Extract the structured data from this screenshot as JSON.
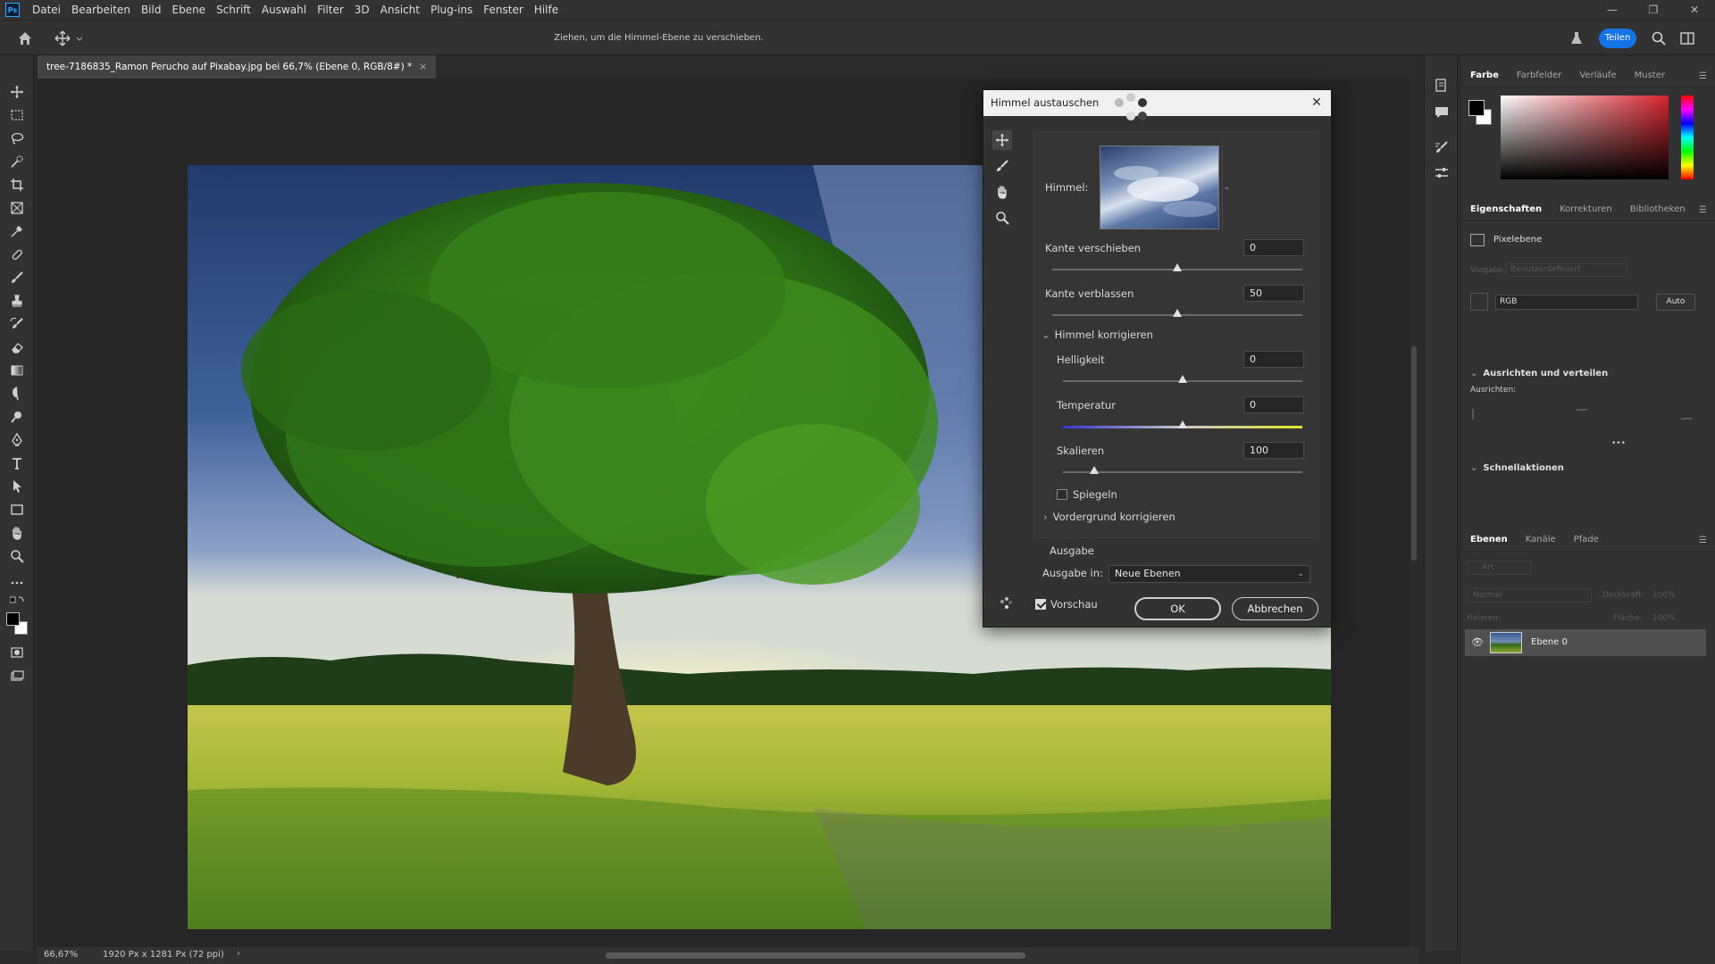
{
  "app": {
    "logo": "Ps",
    "menu": [
      "Datei",
      "Bearbeiten",
      "Bild",
      "Ebene",
      "Schrift",
      "Auswahl",
      "Filter",
      "3D",
      "Ansicht",
      "Plug-ins",
      "Fenster",
      "Hilfe"
    ]
  },
  "options_bar": {
    "hint": "Ziehen, um die Himmel-Ebene zu verschieben.",
    "share_label": "Teilen"
  },
  "document": {
    "tab_title": "tree-7186835_Ramon Perucho auf Pixabay.jpg bei 66,7% (Ebene 0, RGB/8#) *",
    "tab_close": "×",
    "zoom": "66,67%",
    "size_info": "1920 Px x 1281 Px (72 ppi)",
    "status_arrow": "›"
  },
  "dialog": {
    "title": "Himmel austauschen",
    "close": "✕",
    "sky_label": "Himmel:",
    "shift_edge_label": "Kante verschieben",
    "shift_edge_value": "0",
    "shift_edge_level": 0.5,
    "fade_edge_label": "Kante verblassen",
    "fade_edge_value": "50",
    "fade_edge_level": 0.5,
    "sky_adjust_label": "Himmel korrigieren",
    "brightness_label": "Helligkeit",
    "brightness_value": "0",
    "brightness_level": 0.5,
    "temperature_label": "Temperatur",
    "temperature_value": "0",
    "temperature_level": 0.5,
    "scale_label": "Skalieren",
    "scale_value": "100",
    "scale_level": 0.13,
    "flip_label": "Spiegeln",
    "foreground_label": "Vordergrund korrigieren",
    "output_section": "Ausgabe",
    "output_to_label": "Ausgabe in:",
    "output_to_value": "Neue Ebenen",
    "preview_label": "Vorschau",
    "ok_label": "OK",
    "cancel_label": "Abbrechen"
  },
  "color_panel": {
    "tabs": [
      "Farbe",
      "Farbfelder",
      "Verläufe",
      "Muster"
    ],
    "hue_color": "#d6232f"
  },
  "properties_panel": {
    "tabs": [
      "Eigenschaften",
      "Korrekturen",
      "Bibliotheken"
    ],
    "layer_type": "Pixelebene",
    "preset_label": "Vorgabe:",
    "preset_value": "Benutzerdefiniert",
    "channel": "RGB",
    "auto_label": "Auto",
    "align_section": "Ausrichten und verteilen",
    "align_label": "Ausrichten:",
    "more": "•••",
    "quick_actions": "Schnellaktionen"
  },
  "layers_panel": {
    "tabs": [
      "Ebenen",
      "Kanäle",
      "Pfade"
    ],
    "search_placeholder": "Art",
    "blend_mode": "Normal",
    "opacity_label": "Deckkraft:",
    "opacity_value": "100%",
    "lock_label": "Fixieren:",
    "fill_label": "Fläche:",
    "fill_value": "100%",
    "layer_name": "Ebene 0"
  }
}
